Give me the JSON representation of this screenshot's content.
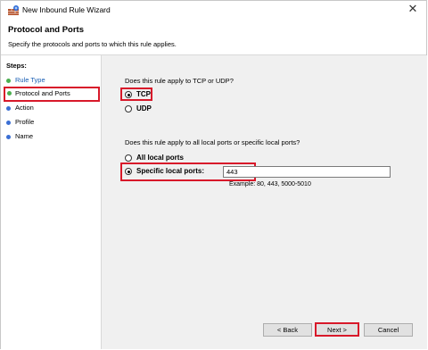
{
  "window": {
    "title": "New Inbound Rule Wizard",
    "close_glyph": "✕",
    "icon": "firewall-icon"
  },
  "header": {
    "title": "Protocol and Ports",
    "subtitle": "Specify the protocols and ports to which this rule applies."
  },
  "steps": {
    "label": "Steps:",
    "items": [
      {
        "label": "Rule Type",
        "color": "#4caf50",
        "text_color": "#1a5fb4"
      },
      {
        "label": "Protocol and Ports",
        "color": "#4caf50",
        "text_color": "#000000"
      },
      {
        "label": "Action",
        "color": "#3b6fd4",
        "text_color": "#000000"
      },
      {
        "label": "Profile",
        "color": "#3b6fd4",
        "text_color": "#000000"
      },
      {
        "label": "Name",
        "color": "#3b6fd4",
        "text_color": "#000000"
      }
    ]
  },
  "protocol": {
    "question": "Does this rule apply to TCP or UDP?",
    "tcp": "TCP",
    "udp": "UDP",
    "selected": "TCP"
  },
  "ports": {
    "question": "Does this rule apply to all local ports or specific local ports?",
    "all": "All local ports",
    "specific": "Specific local ports:",
    "selected": "Specific local ports:",
    "value": "443",
    "example": "Example: 80, 443, 5000-5010"
  },
  "buttons": {
    "back": "< Back",
    "next": "Next >",
    "cancel": "Cancel"
  },
  "colors": {
    "highlight": "#d8192a",
    "panel_bg": "#f0f0f0"
  }
}
